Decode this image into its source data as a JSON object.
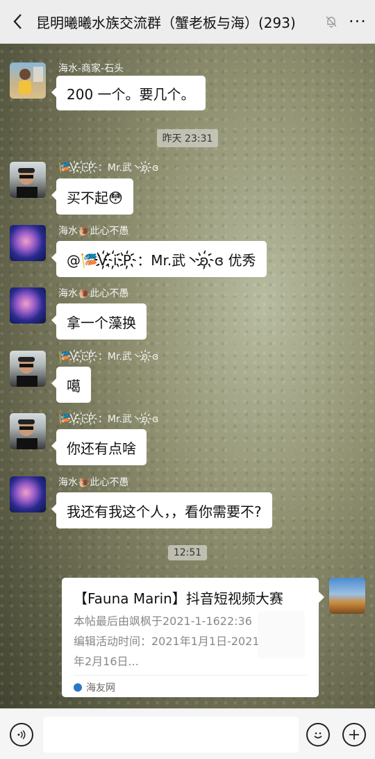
{
  "header": {
    "back_icon": "chevron-left-icon",
    "title": "昆明曦曦水族交流群（蟹老板与海）(293)",
    "mute_icon": "bell-off-icon",
    "more_icon": "more-dots-icon",
    "more_label": "···"
  },
  "messages": [
    {
      "sender": "海水-商家-石头",
      "text": "200 一个。要几个。",
      "avatar": "person-avatar-boy"
    },
    {
      "sender": "🎏V҉i҉P҉：Mr.武丶ʚ҉ɞ",
      "text": "买不起😳",
      "avatar": "person-avatar-sunglasses"
    },
    {
      "sender": "海水🐌此心不愚",
      "text": "@🎏V҉i҉P҉：Mr.武丶ʚ҉ɞ 优秀",
      "avatar": "jellyfish-avatar"
    },
    {
      "sender": "海水🐌此心不愚",
      "text": "拿一个藻换",
      "avatar": "jellyfish-avatar"
    },
    {
      "sender": "🎏V҉i҉P҉：Mr.武丶ʚ҉ɞ",
      "text": "噶",
      "avatar": "person-avatar-sunglasses"
    },
    {
      "sender": "🎏V҉i҉P҉：Mr.武丶ʚ҉ɞ",
      "text": "你还有点啥",
      "avatar": "person-avatar-sunglasses"
    },
    {
      "sender": "海水🐌此心不愚",
      "text": "我还有我这个人，，看你需要不?",
      "avatar": "jellyfish-avatar"
    }
  ],
  "timestamps": [
    "昨天 23:31",
    "12:51"
  ],
  "link_card": {
    "title": "【Fauna Marin】抖音短视频大赛",
    "desc": "本帖最后由飒枫于2021-1-1622:36编辑活动时间：2021年1月1日-2021年2月16日...",
    "source": "海友网"
  },
  "bottom": {
    "voice_icon": "voice-icon",
    "emoji_icon": "emoji-icon",
    "plus_icon": "plus-icon",
    "input_value": ""
  }
}
